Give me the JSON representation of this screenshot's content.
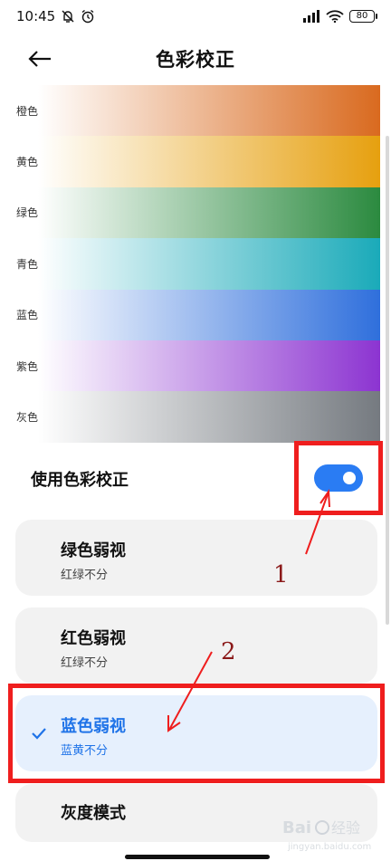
{
  "status_bar": {
    "time": "10:45",
    "battery": "80"
  },
  "header": {
    "title": "色彩校正"
  },
  "color_bars": [
    {
      "label": "橙色",
      "color": "#d96a1f"
    },
    {
      "label": "黄色",
      "color": "#e6a00f"
    },
    {
      "label": "绿色",
      "color": "#2b8a3f"
    },
    {
      "label": "青色",
      "color": "#1aaab9"
    },
    {
      "label": "蓝色",
      "color": "#2f6fdc"
    },
    {
      "label": "紫色",
      "color": "#8c34d1"
    },
    {
      "label": "灰色",
      "color": "#757a80"
    }
  ],
  "toggle": {
    "label": "使用色彩校正",
    "on": true
  },
  "options": [
    {
      "title": "绿色弱视",
      "subtitle": "红绿不分",
      "selected": false
    },
    {
      "title": "红色弱视",
      "subtitle": "红绿不分",
      "selected": false
    },
    {
      "title": "蓝色弱视",
      "subtitle": "蓝黄不分",
      "selected": true
    },
    {
      "title": "灰度模式",
      "subtitle": "",
      "selected": false
    }
  ],
  "annotations": {
    "num1": "1",
    "num2": "2"
  },
  "colors": {
    "accent": "#2a7cf3",
    "annotation_red": "#ef1e1e",
    "selected_card": "#e6f0fd",
    "card": "#f2f2f2"
  }
}
